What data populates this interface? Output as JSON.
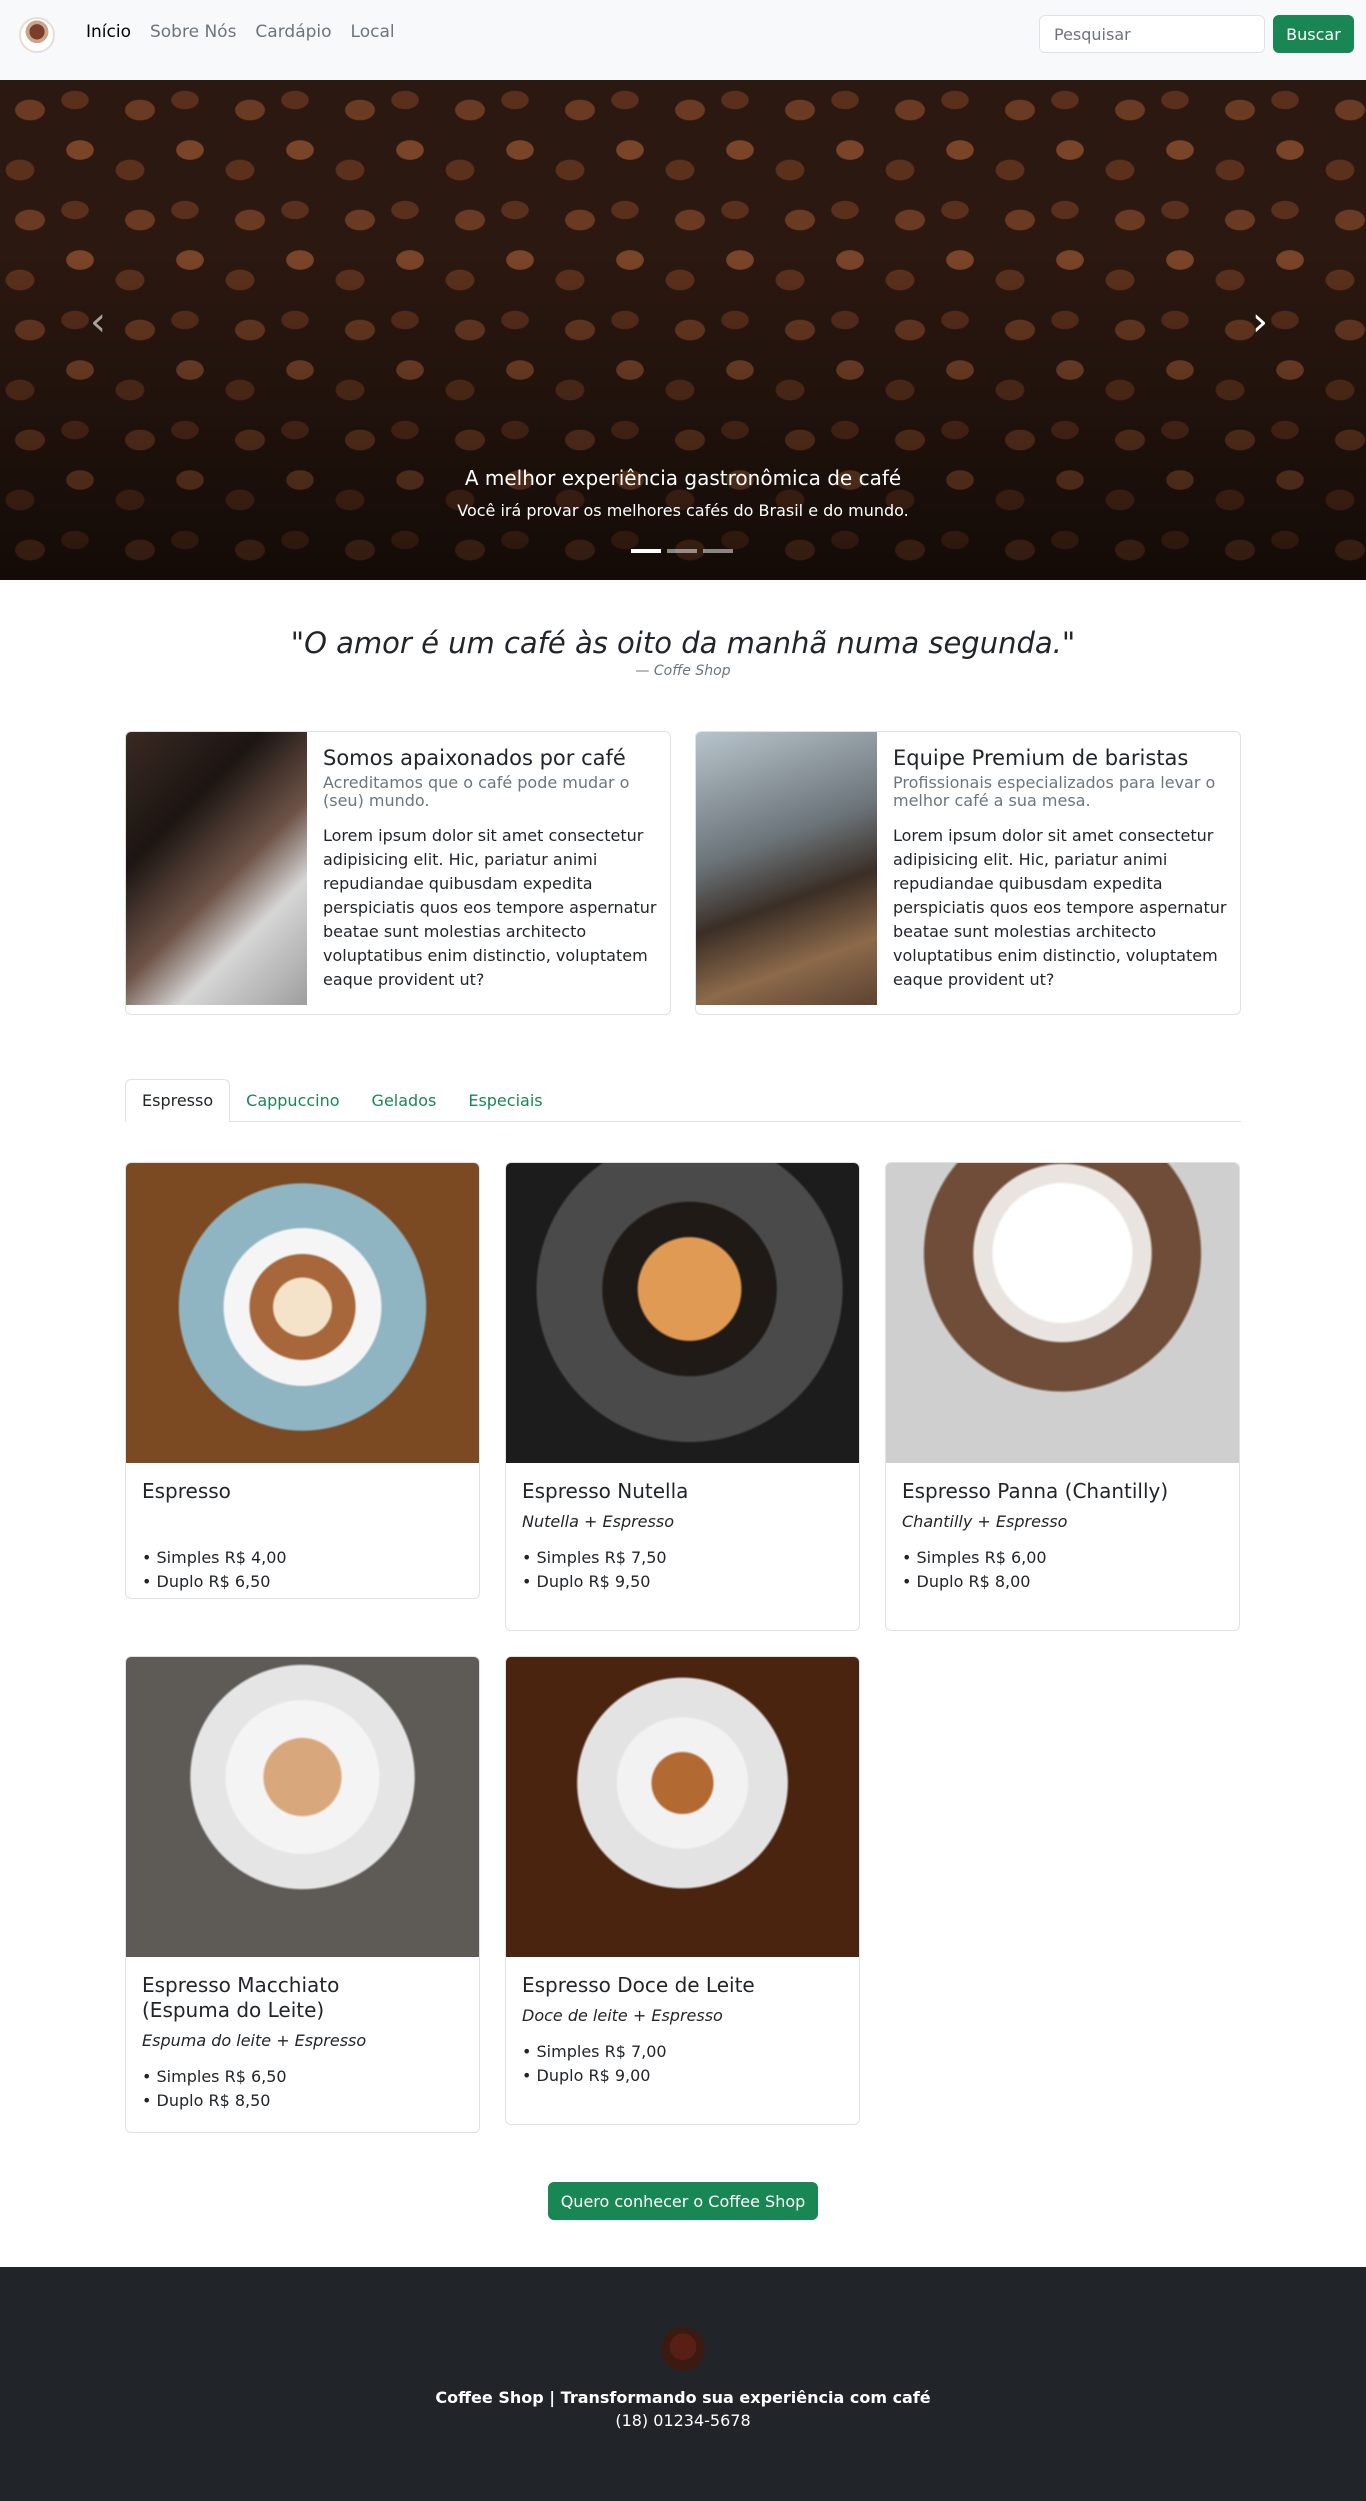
{
  "nav": {
    "links": [
      "Início",
      "Sobre Nós",
      "Cardápio",
      "Local"
    ],
    "search_placeholder": "Pesquisar",
    "search_button": "Buscar"
  },
  "carousel": {
    "title": "A melhor experiência gastronômica de café",
    "subtitle": "Você irá provar os melhores cafés do Brasil e do mundo.",
    "slide_count": 3,
    "active_slide": 1
  },
  "quote": {
    "text": "\"O amor é um café às oito da manhã numa segunda.\"",
    "source": "— Coffe Shop"
  },
  "features": [
    {
      "title": "Somos apaixonados por café",
      "subtitle": "Acreditamos que o café pode mudar o (seu) mundo.",
      "text": "Lorem ipsum dolor sit amet consectetur adipisicing elit. Hic, pariatur animi repudiandae quibusdam expedita perspiciatis quos eos tempore aspernatur beatae sunt molestias architecto voluptatibus enim distinctio, voluptatem eaque provident ut?"
    },
    {
      "title": "Equipe Premium de baristas",
      "subtitle": "Profissionais especializados para levar o melhor café a sua mesa.",
      "text": "Lorem ipsum dolor sit amet consectetur adipisicing elit. Hic, pariatur animi repudiandae quibusdam expedita perspiciatis quos eos tempore aspernatur beatae sunt molestias architecto voluptatibus enim distinctio, voluptatem eaque provident ut?"
    }
  ],
  "tabs": [
    "Espresso",
    "Cappuccino",
    "Gelados",
    "Especiais"
  ],
  "products": [
    {
      "name": "Espresso",
      "desc": "",
      "prices": [
        "• Simples R$ 4,00",
        "• Duplo R$ 6,50"
      ]
    },
    {
      "name": "Espresso Nutella",
      "desc": "Nutella + Espresso",
      "prices": [
        "• Simples R$ 7,50",
        "• Duplo R$ 9,50"
      ]
    },
    {
      "name": "Espresso Panna (Chantilly)",
      "desc": "Chantilly + Espresso",
      "prices": [
        "• Simples R$ 6,00",
        "• Duplo R$ 8,00"
      ]
    },
    {
      "name": "Espresso Macchiato (Espuma do Leite)",
      "desc": "Espuma do leite + Espresso",
      "prices": [
        "• Simples R$ 6,50",
        "• Duplo R$ 8,50"
      ]
    },
    {
      "name": "Espresso Doce de Leite",
      "desc": "Doce de leite + Espresso",
      "prices": [
        "• Simples R$ 7,00",
        "• Duplo R$ 9,00"
      ]
    }
  ],
  "cta": "Quero conhecer o Coffee Shop",
  "footer": {
    "title": "Coffee Shop | Transformando sua experiência com café",
    "phone": "(18) 01234-5678"
  },
  "colors": {
    "primary": "#198754",
    "footer_bg": "#212529",
    "navbar_bg": "#f8f9fa"
  }
}
